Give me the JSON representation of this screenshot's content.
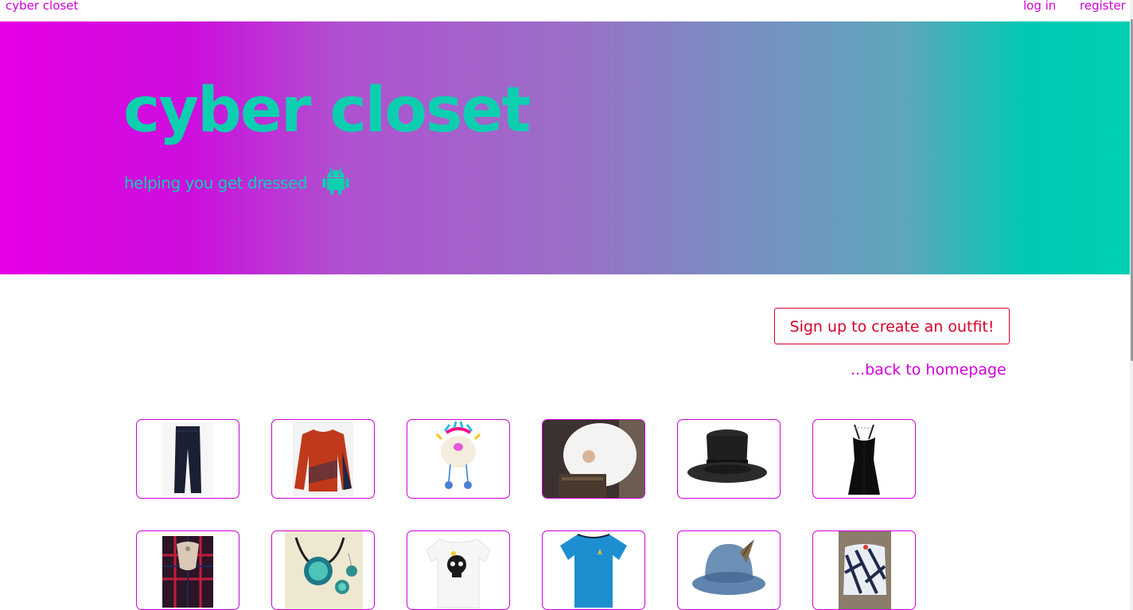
{
  "nav": {
    "brand": "cyber closet",
    "login": "log in",
    "register": "register"
  },
  "hero": {
    "title": "cyber closet",
    "subtitle": "helping you get dressed",
    "icon": "android-icon"
  },
  "main": {
    "cta_label": "Sign up to create an outfit!",
    "back_link": "...back to homepage"
  },
  "items": [
    {
      "icon": "jeans-icon"
    },
    {
      "icon": "blouse-icon"
    },
    {
      "icon": "winter-hat-icon"
    },
    {
      "icon": "pope-photo-icon"
    },
    {
      "icon": "top-hat-icon"
    },
    {
      "icon": "black-dress-icon"
    },
    {
      "icon": "kilt-icon"
    },
    {
      "icon": "pendant-necklace-icon"
    },
    {
      "icon": "skull-tshirt-icon"
    },
    {
      "icon": "blue-tshirt-icon"
    },
    {
      "icon": "bowler-hat-icon"
    },
    {
      "icon": "patterned-cape-icon"
    }
  ],
  "colors": {
    "accent": "#d000d8",
    "teal": "#0ccfb0",
    "cta": "#d8002a"
  }
}
